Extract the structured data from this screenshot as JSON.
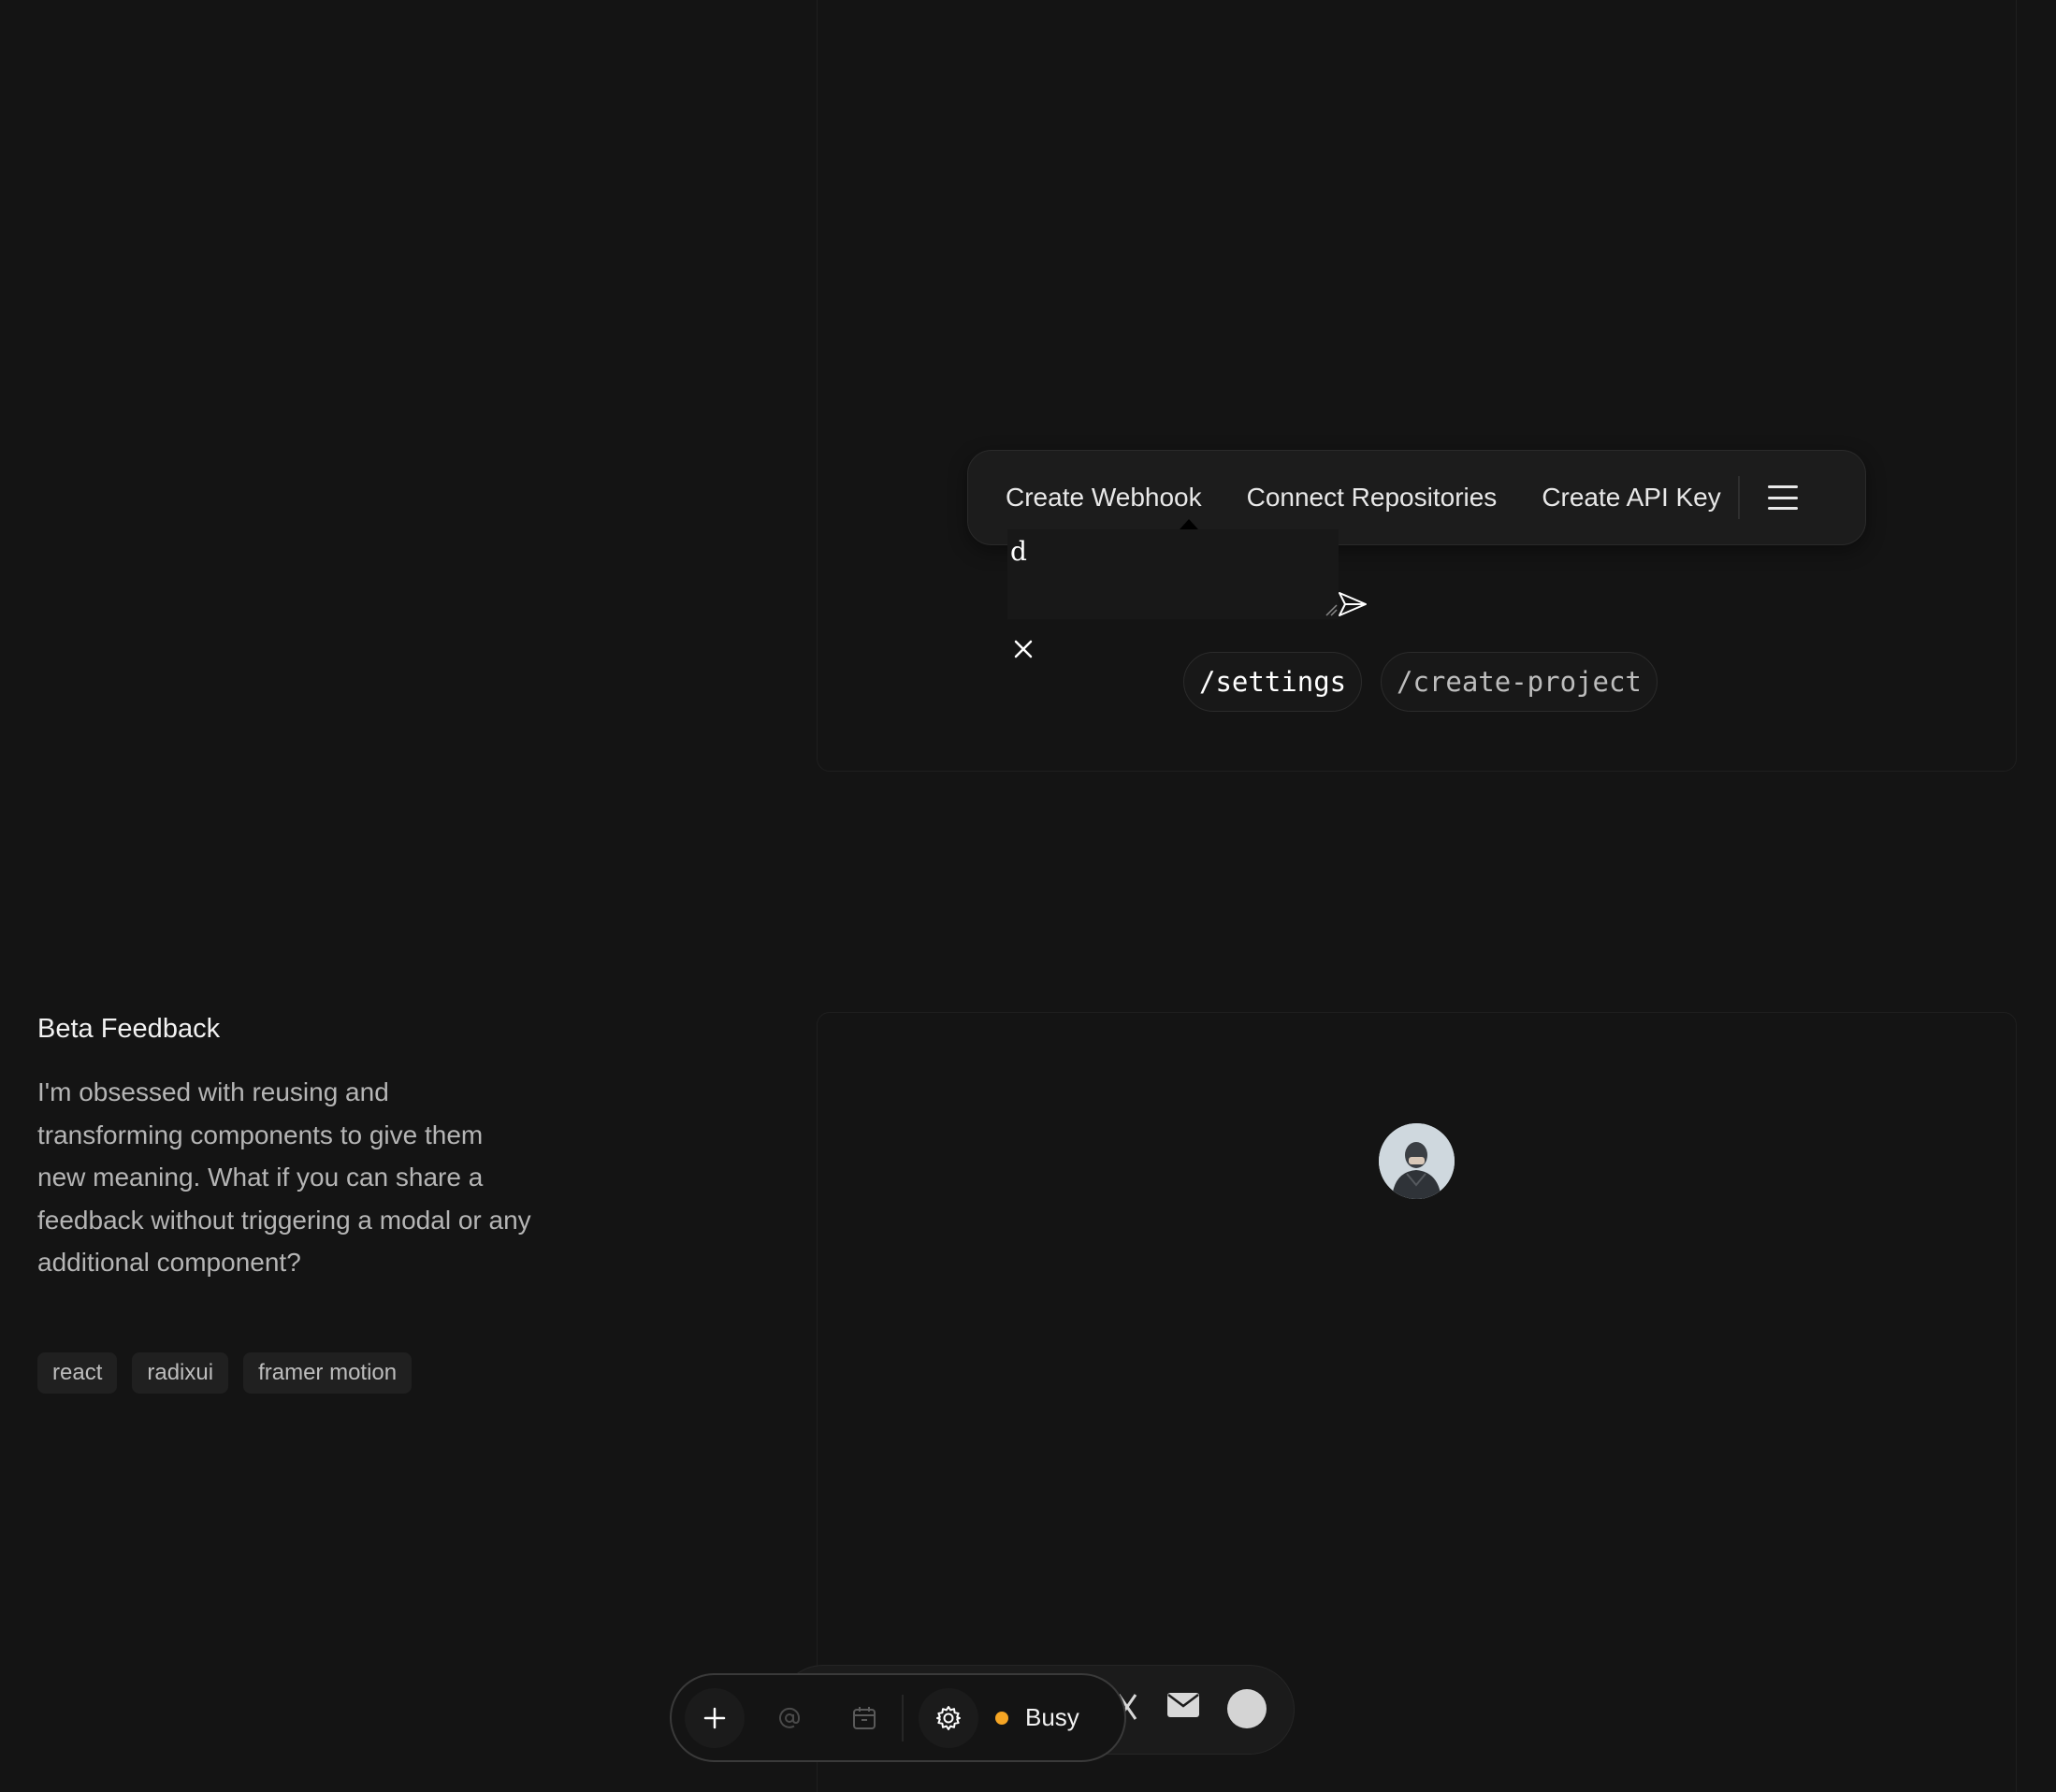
{
  "action_bar": {
    "items": [
      "Create Webhook",
      "Connect Repositories",
      "Create API Key"
    ],
    "menu_icon": "hamburger-menu-icon"
  },
  "feedback": {
    "value": "d",
    "send_icon": "send-icon",
    "close_icon": "close-icon",
    "resize_icon": "resize-handle-icon"
  },
  "commands": [
    "/settings",
    "/create-project"
  ],
  "description": {
    "title": "Beta Feedback",
    "body": "I'm obsessed with reusing and transforming components to give them new meaning. What if you can share a feedback without triggering a modal or any additional component?",
    "tags": [
      "react",
      "radixui",
      "framer motion"
    ]
  },
  "toolbar": {
    "status_label": "Busy",
    "status_color": "#f5a524",
    "icons": [
      "plus-icon",
      "at-sign-icon",
      "calendar-icon",
      "gear-icon"
    ]
  },
  "back_dock": {
    "icons": [
      "x-logo-icon",
      "mail-icon",
      "avatar-circle-icon"
    ]
  },
  "colors": {
    "background": "#141414",
    "panel_border": "#1f1f1f",
    "text_primary": "#e8e8e8",
    "text_secondary": "#b5b5b5"
  }
}
